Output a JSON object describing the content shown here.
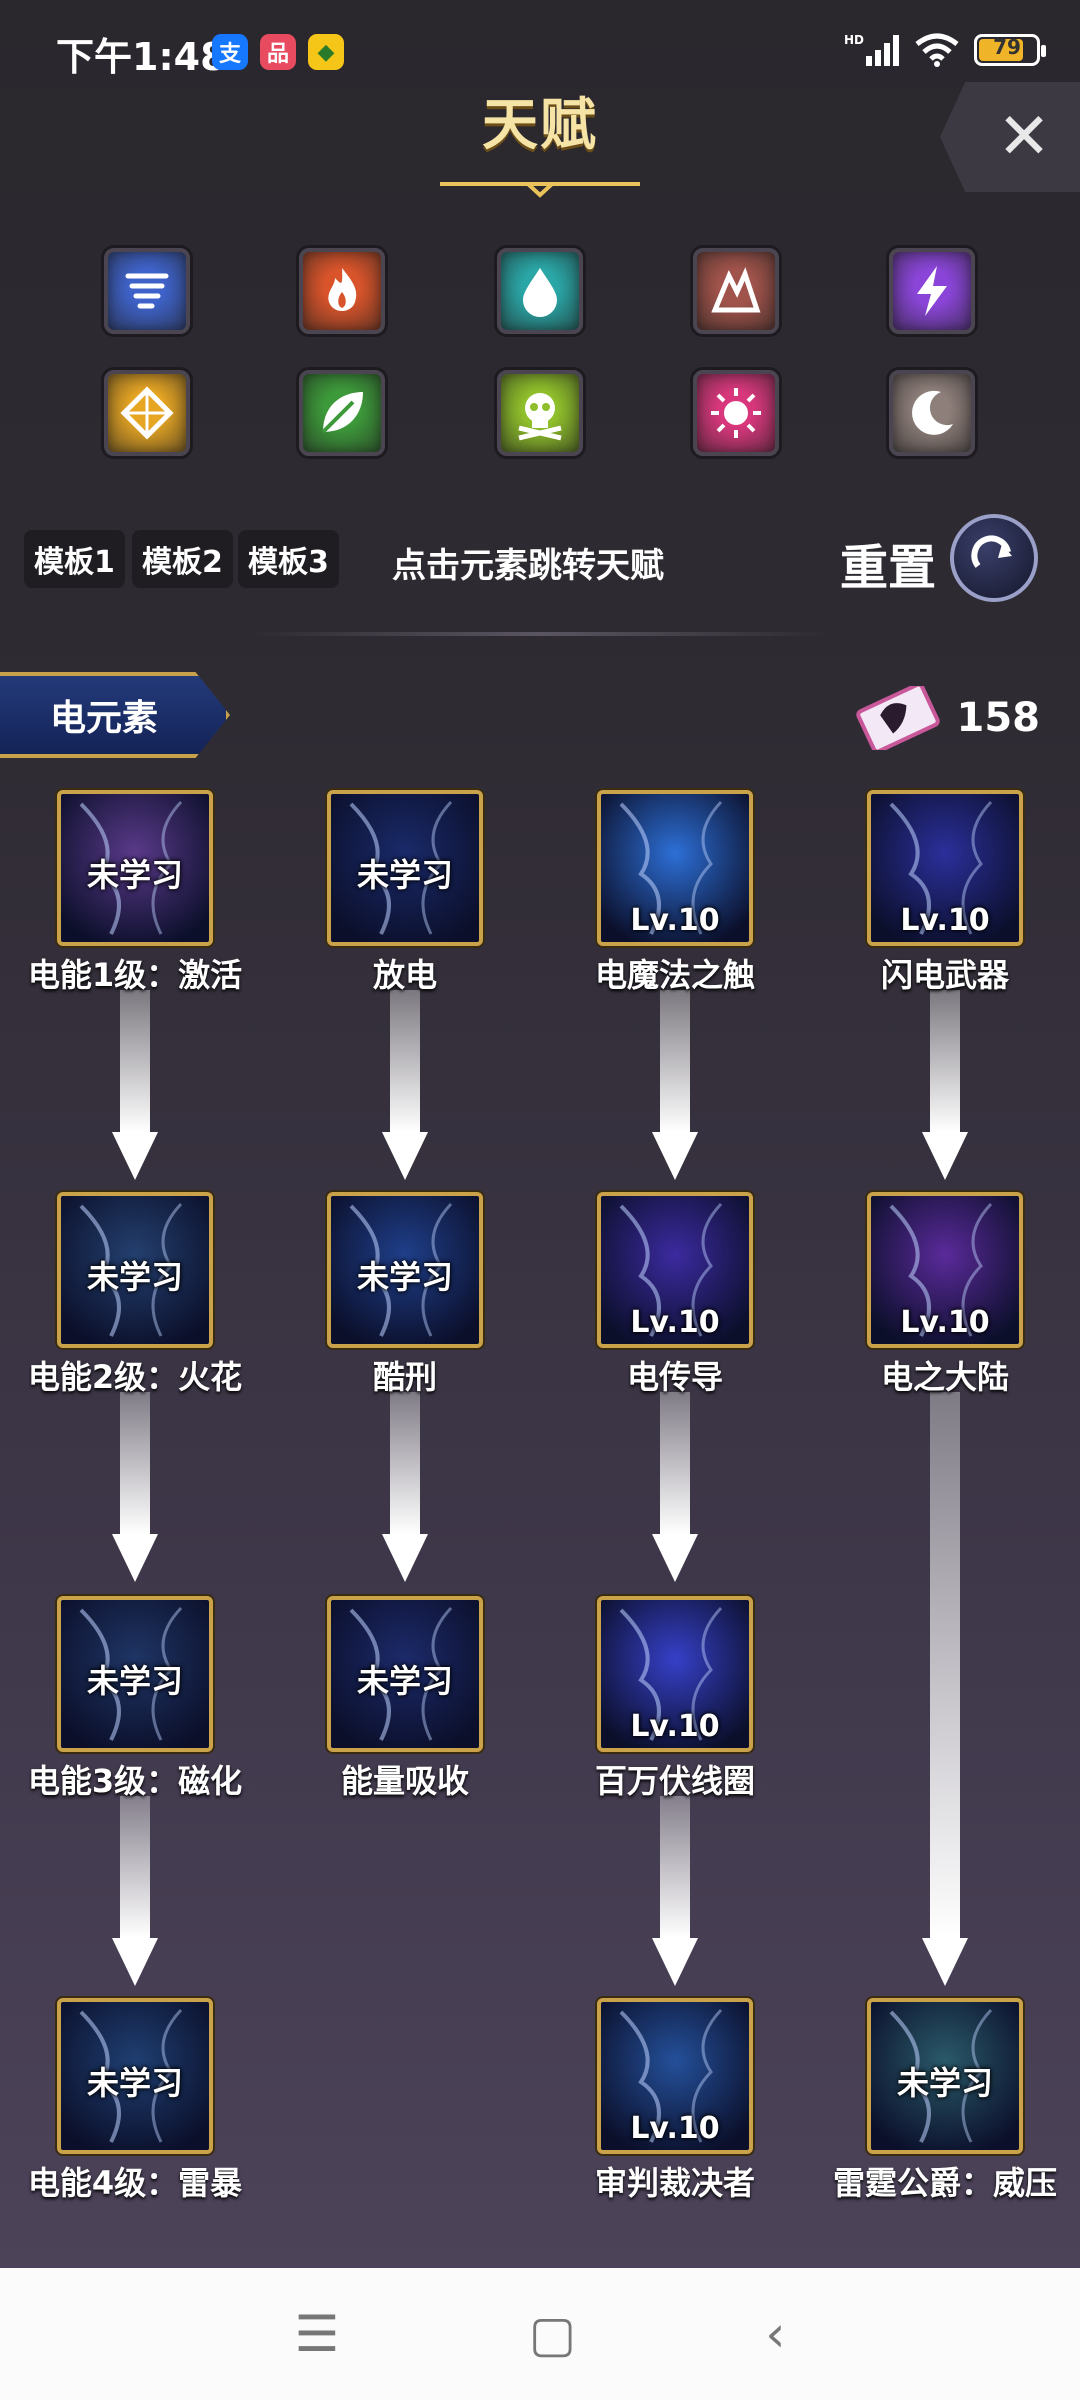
{
  "status_bar": {
    "time": "下午1:48",
    "battery": "79",
    "app_badges": [
      {
        "glyph": "支",
        "color": "#1677ff"
      },
      {
        "glyph": "品",
        "color": "#e84a5f"
      },
      {
        "glyph": "◆",
        "color": "#f5c518"
      }
    ]
  },
  "header": {
    "title": "天赋"
  },
  "elements": [
    {
      "icon": "whirlwind-icon",
      "color": "#3e62c9"
    },
    {
      "icon": "fire-icon",
      "color": "#d9542a"
    },
    {
      "icon": "water-drop-icon",
      "color": "#2aa6a6"
    },
    {
      "icon": "earth-icon",
      "color": "#a0534a"
    },
    {
      "icon": "lightning-icon",
      "color": "#8a45d8"
    },
    {
      "icon": "light-icon",
      "color": "#e6a523"
    },
    {
      "icon": "leaf-icon",
      "color": "#3d9a3a"
    },
    {
      "icon": "poison-skull-icon",
      "color": "#8fbf2a"
    },
    {
      "icon": "sun-icon",
      "color": "#d8377c"
    },
    {
      "icon": "moon-icon",
      "color": "#8e7f7a"
    }
  ],
  "templates": [
    "模板1",
    "模板2",
    "模板3"
  ],
  "hint": "点击元素跳转天赋",
  "reset_label": "重置",
  "element_tag": "电元素",
  "points": "158",
  "skills": [
    {
      "name": "电能1级：激活",
      "status": "未学习",
      "learned": false,
      "color": "#5a3a8a"
    },
    {
      "name": "放电",
      "status": "未学习",
      "learned": false,
      "color": "#1a2a6a"
    },
    {
      "name": "电魔法之触",
      "status": "Lv.10",
      "learned": true,
      "color": "#2d6fd6"
    },
    {
      "name": "闪电武器",
      "status": "Lv.10",
      "learned": true,
      "color": "#2b2f9a"
    },
    {
      "name": "电能2级：火花",
      "status": "未学习",
      "learned": false,
      "color": "#24406f"
    },
    {
      "name": "酷刑",
      "status": "未学习",
      "learned": false,
      "color": "#1f3f8a"
    },
    {
      "name": "电传导",
      "status": "Lv.10",
      "learned": true,
      "color": "#3b2a9f"
    },
    {
      "name": "电之大陆",
      "status": "Lv.10",
      "learned": true,
      "color": "#5a2a9a"
    },
    {
      "name": "电能3级：磁化",
      "status": "未学习",
      "learned": false,
      "color": "#1f3565"
    },
    {
      "name": "能量吸收",
      "status": "未学习",
      "learned": false,
      "color": "#1c2a6a"
    },
    {
      "name": "百万伏线圈",
      "status": "Lv.10",
      "learned": true,
      "color": "#3640c8"
    },
    {
      "name": "电能4级：雷暴",
      "status": "未学习",
      "learned": false,
      "color": "#1f3f72"
    },
    {
      "name": "审判裁决者",
      "status": "Lv.10",
      "learned": true,
      "color": "#24509a"
    },
    {
      "name": "雷霆公爵：威压",
      "status": "未学习",
      "learned": false,
      "color": "#2a5a6a"
    }
  ],
  "nav": {
    "menu": "☰",
    "home": "▢",
    "back": "‹"
  }
}
